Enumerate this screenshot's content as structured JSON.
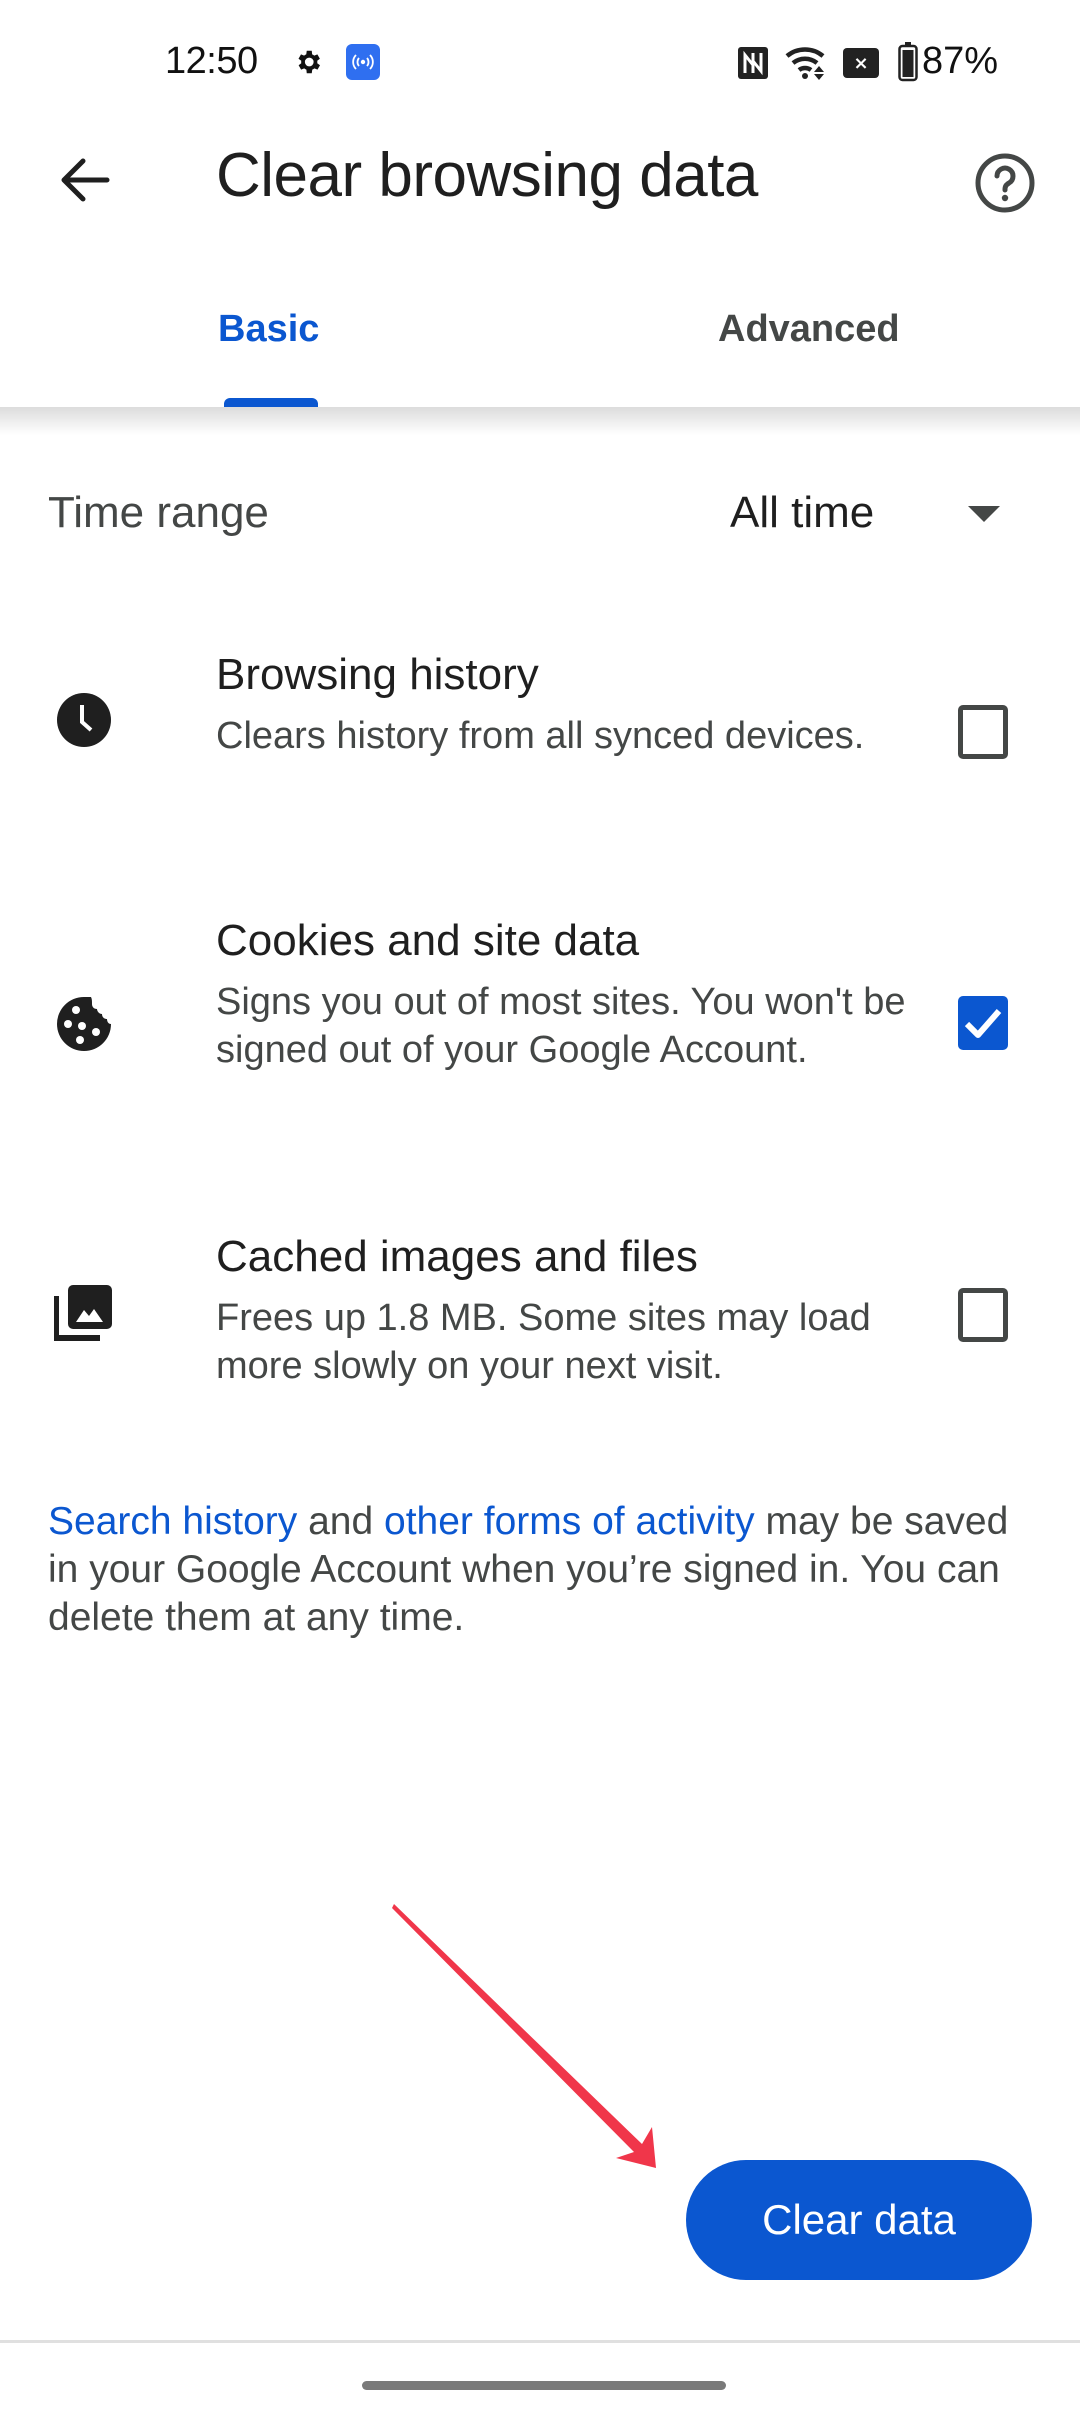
{
  "status_bar": {
    "time": "12:50",
    "icons": [
      "gear-icon",
      "hotspot-icon",
      "nfc-icon",
      "wifi-icon",
      "no-sim-icon",
      "battery-icon"
    ],
    "no_sim_glyph": "×",
    "battery_percent": "87%"
  },
  "app_bar": {
    "title": "Clear browsing data",
    "back_icon": "arrow-left-icon",
    "help_icon": "help-circle-icon"
  },
  "tabs": [
    {
      "label": "Basic",
      "selected": true
    },
    {
      "label": "Advanced",
      "selected": false
    }
  ],
  "time_range": {
    "label": "Time range",
    "value": "All time"
  },
  "options": [
    {
      "icon": "clock-icon",
      "title": "Browsing history",
      "description": "Clears history from all synced devices.",
      "checked": false
    },
    {
      "icon": "cookie-icon",
      "title": "Cookies and site data",
      "description": "Signs you out of most sites. You won't be signed out of your Google Account.",
      "checked": true
    },
    {
      "icon": "photo-library-icon",
      "title": "Cached images and files",
      "description": "Frees up 1.8 MB. Some sites may load more slowly on your next visit.",
      "checked": false
    }
  ],
  "footer_note": {
    "link1": "Search history",
    "text1": " and ",
    "link2": "other forms of activity",
    "text2": " may be saved in your Google Account when you’re signed in. You can delete them at any time."
  },
  "actions": {
    "clear_data_label": "Clear data"
  },
  "colors": {
    "accent": "#0b57d0",
    "annotation_arrow": "#f0364a"
  }
}
